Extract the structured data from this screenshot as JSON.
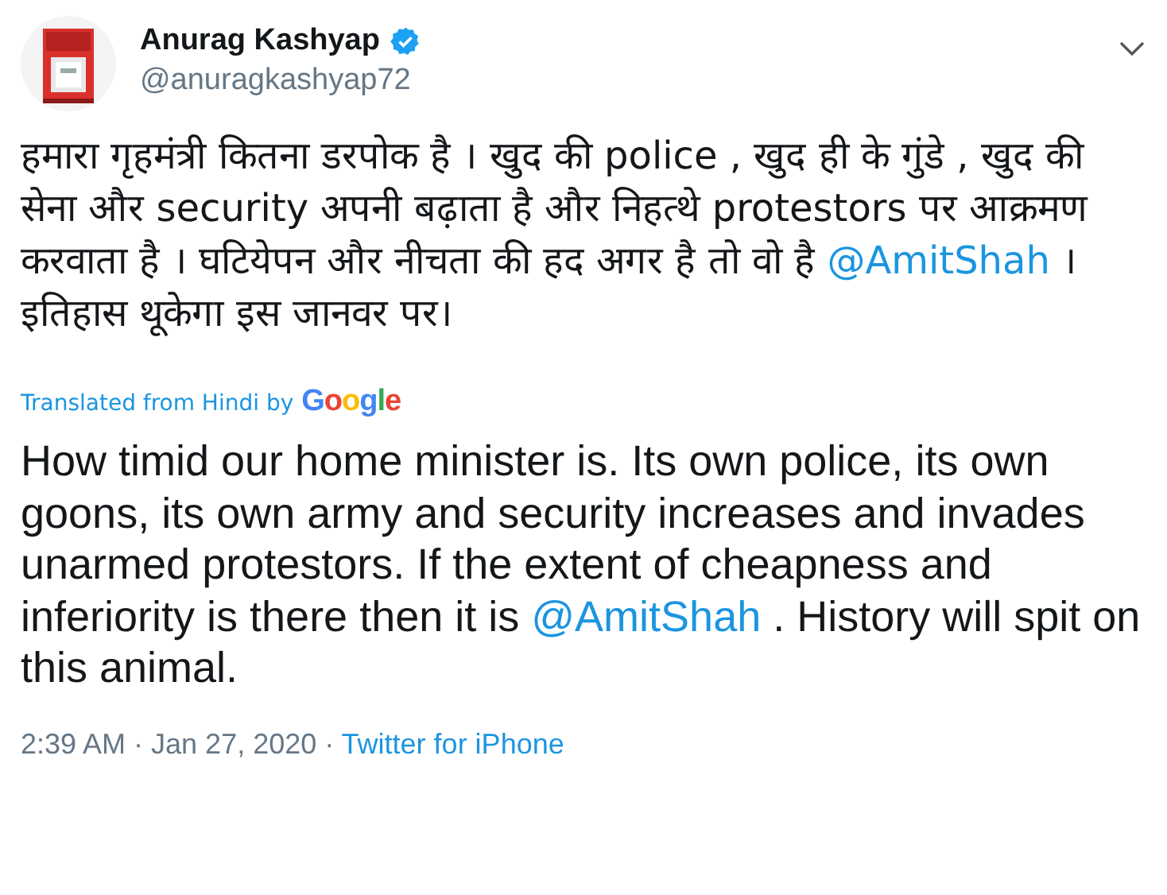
{
  "author": {
    "name": "Anurag Kashyap",
    "verified": true,
    "handle": "@anuragkashyap72"
  },
  "original_text": [
    {
      "kind": "text",
      "text": "हमारा गृहमंत्री कितना डरपोक है । खुद की police , खुद ही के गुंडे , खुद की सेना और security अपनी बढ़ाता है और निहत्थे protestors पर आक्रमण करवाता है । घटियेपन और नीचता की हद अगर है तो वो है "
    },
    {
      "kind": "mention",
      "text": "@AmitShah"
    },
    {
      "kind": "text",
      "text": " । इतिहास थूकेगा इस जानवर पर।"
    }
  ],
  "translation_label": "Translated from Hindi by",
  "translation_provider": "Google",
  "translated_text": [
    {
      "kind": "text",
      "text": "How timid our home minister is. Its own police, its own goons, its own army and security increases and invades unarmed protestors. If the extent of cheapness and inferiority is there then it is "
    },
    {
      "kind": "mention",
      "text": "@AmitShah"
    },
    {
      "kind": "text",
      "text": " . History will spit on this animal."
    }
  ],
  "timestamp": "2:39 AM · Jan 27, 2020 · ",
  "source": "Twitter for iPhone"
}
